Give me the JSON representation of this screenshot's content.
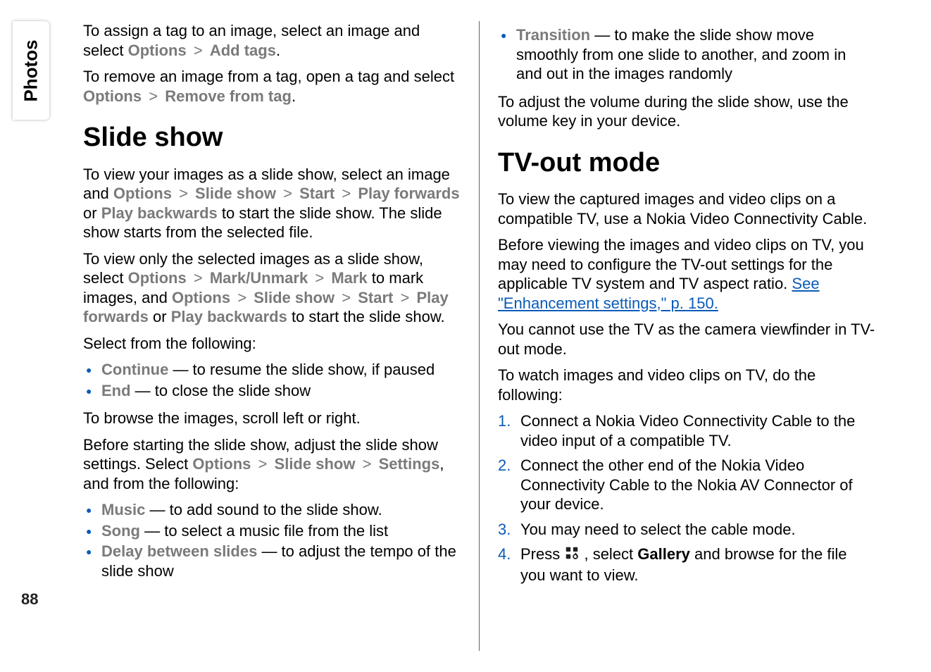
{
  "sidebar": {
    "label": "Photos"
  },
  "page_number": "88",
  "left": {
    "p1a": "To assign a tag to an image, select an image and select ",
    "p1_m1": "Options",
    "p1_m2": "Add tags",
    "p1_end": ".",
    "p2a": "To remove an image from a tag, open a tag and select ",
    "p2_m1": "Options",
    "p2_m2": "Remove from tag",
    "p2_end": ".",
    "h1": "Slide show",
    "p3a": "To view your images as a slide show, select an image and ",
    "p3_m1": "Options",
    "p3_m2": "Slide show",
    "p3_m3": "Start",
    "p3_m4": "Play forwards",
    "p3b": " or ",
    "p3_m5": "Play backwards",
    "p3c": " to start the slide show. The slide show starts from the selected file.",
    "p4a": "To view only the selected images as a slide show, select ",
    "p4_m1": "Options",
    "p4_m2": "Mark/Unmark",
    "p4_m3": "Mark",
    "p4b": " to mark images, and ",
    "p4_m4": "Options",
    "p4_m5": "Slide show",
    "p4_m6": "Start",
    "p4_m7": "Play forwards",
    "p4c": " or ",
    "p4_m8": "Play backwards",
    "p4d": " to start the slide show.",
    "p5": "Select from the following:",
    "li1_label": "Continue",
    "li1_text": "  — to resume the slide show, if paused",
    "li2_label": "End",
    "li2_text": "  — to close the slide show",
    "p6": "To browse the images, scroll left or right.",
    "p7a": "Before starting the slide show, adjust the slide show settings. Select ",
    "p7_m1": "Options",
    "p7_m2": "Slide show",
    "p7_m3": "Settings",
    "p7b": ", and from the following:",
    "li3_label": "Music",
    "li3_text": "  — to add sound to the slide show.",
    "li4_label": "Song",
    "li4_text": "  — to select a music file from the list",
    "li5_label": "Delay between slides",
    "li5_text": "  — to adjust the tempo of the slide show"
  },
  "right": {
    "li6_label": "Transition",
    "li6_text": "  — to make the slide show move smoothly from one slide to another, and zoom in and out in the images randomly",
    "p1": "To adjust the volume during the slide show, use the volume key in your device.",
    "h1": "TV-out mode",
    "p2": "To view the captured images and video clips on a compatible TV, use a Nokia Video Connectivity Cable.",
    "p3a": "Before viewing the images and video clips on TV, you may need to configure the TV-out settings for the applicable TV system and TV aspect ratio. ",
    "link1": "See \"Enhancement settings,\" p. 150.",
    "p4": "You cannot use the TV as the camera viewfinder in TV-out mode.",
    "p5": "To watch images and video clips on TV, do the following:",
    "ol1": "Connect a Nokia Video Connectivity Cable to the video input of a compatible TV.",
    "ol2": "Connect the other end of the Nokia Video Connectivity Cable to the Nokia AV Connector of your device.",
    "ol3": "You may need to select the cable mode.",
    "ol4a": "Press ",
    "ol4b": " , select ",
    "ol4_bold": "Gallery",
    "ol4c": " and browse for the file you want to view."
  },
  "sep": ">"
}
